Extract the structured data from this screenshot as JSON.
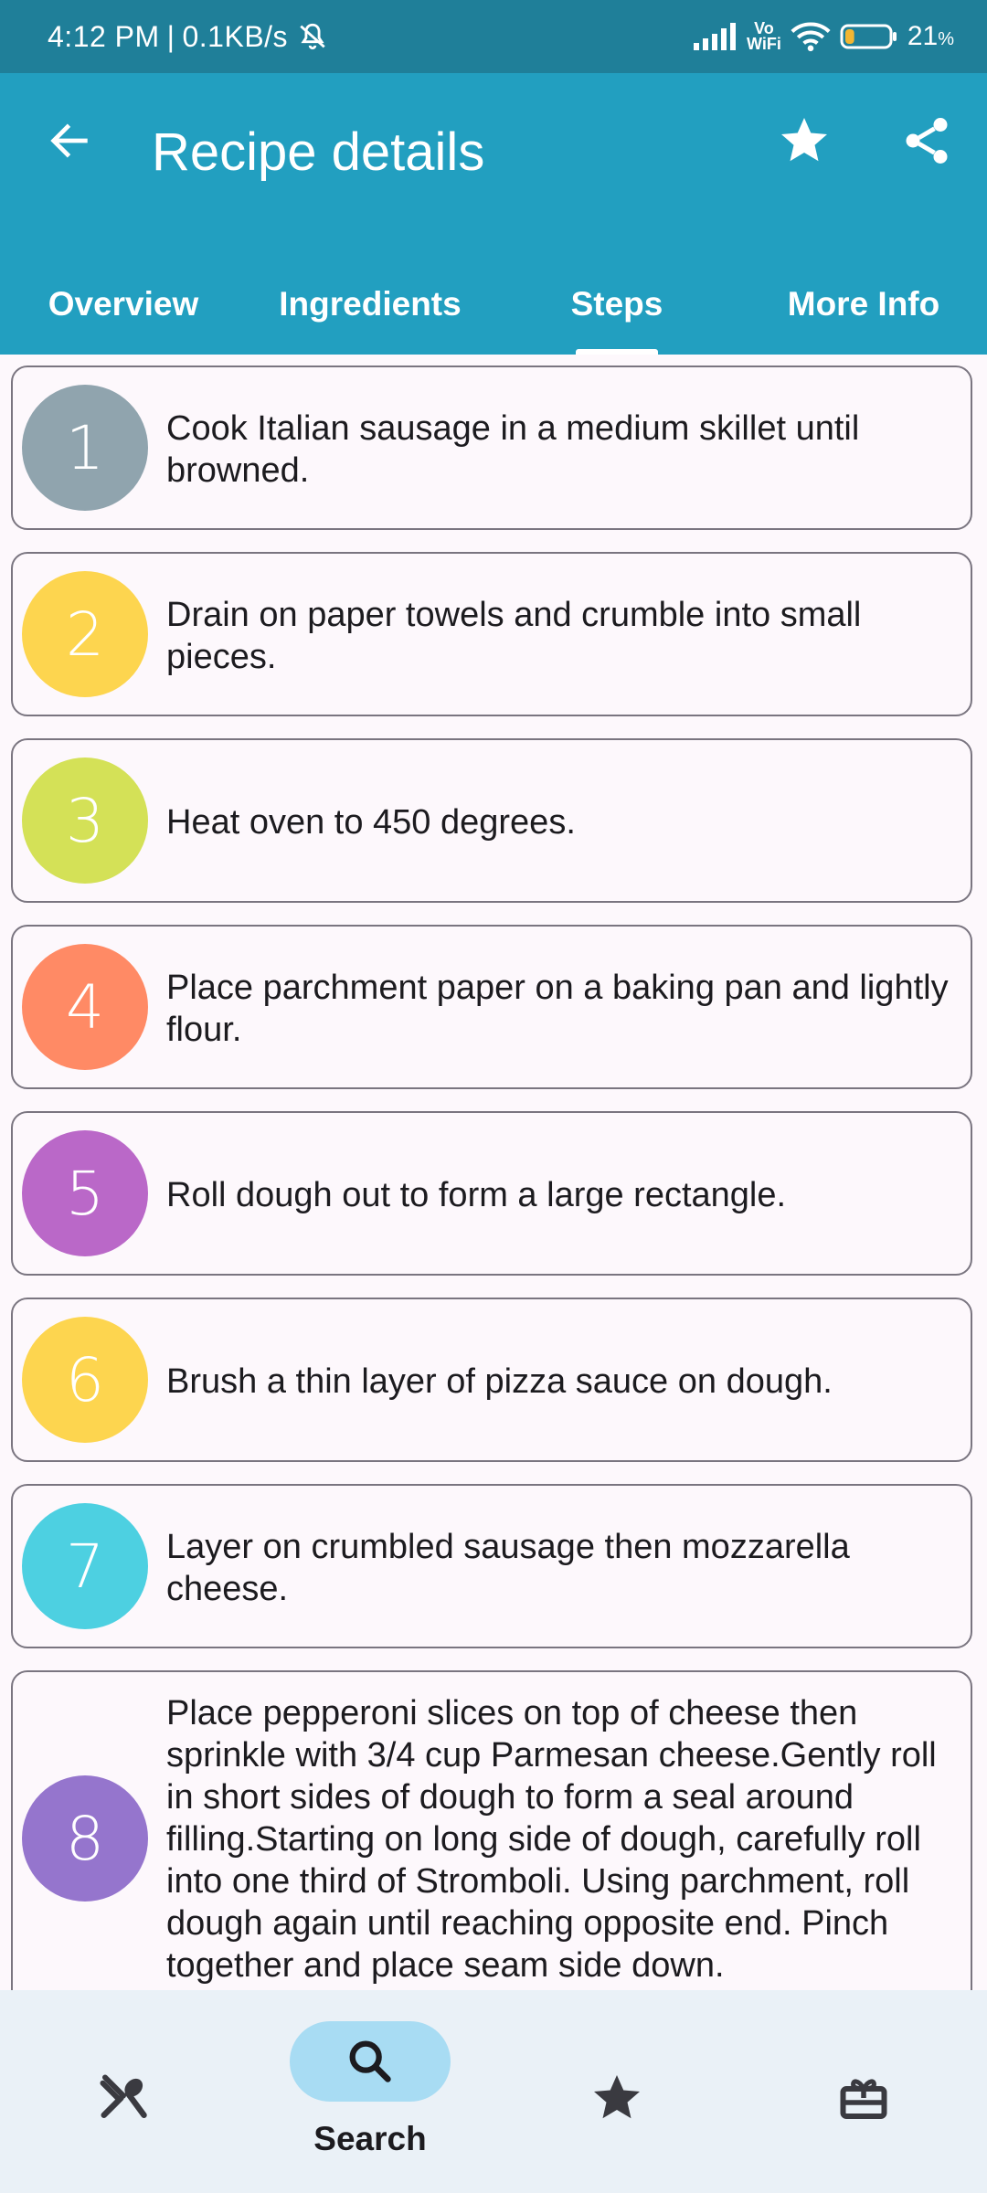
{
  "status_bar": {
    "time": "4:12 PM",
    "separator": "|",
    "speed": "0.1KB/s",
    "vo_label": "Vo",
    "wifi_label": "WiFi",
    "battery_percent": "21",
    "percent_sign": "%",
    "battery_level": 0.21
  },
  "app_bar": {
    "title": "Recipe details",
    "icons": [
      "back-arrow-icon",
      "star-icon",
      "share-icon"
    ]
  },
  "tabs": [
    {
      "label": "Overview",
      "selected": false
    },
    {
      "label": "Ingredients",
      "selected": false
    },
    {
      "label": "Steps",
      "selected": true
    },
    {
      "label": "More Info",
      "selected": false
    }
  ],
  "steps": [
    {
      "number": "1",
      "text": "Cook Italian sausage in a medium skillet until browned.",
      "color": "#90a4ae"
    },
    {
      "number": "2",
      "text": "Drain on paper towels and crumble into small pieces.",
      "color": "#fdd54f"
    },
    {
      "number": "3",
      "text": "Heat oven to 450 degrees.",
      "color": "#d4e157"
    },
    {
      "number": "4",
      "text": "Place parchment paper on a baking pan and lightly flour.",
      "color": "#ff8a65"
    },
    {
      "number": "5",
      "text": "Roll dough out to form a large rectangle.",
      "color": "#ba68c8"
    },
    {
      "number": "6",
      "text": "Brush a thin layer of pizza sauce on dough.",
      "color": "#fdd54f"
    },
    {
      "number": "7",
      "text": "Layer on crumbled sausage then mozzarella cheese.",
      "color": "#4dd0e1"
    },
    {
      "number": "8",
      "text": "Place pepperoni slices on top of cheese then sprinkle with 3/4 cup Parmesan cheese.Gently roll in short sides of dough to form a seal around filling.Starting on long side of dough, carefully roll into one third of Stromboli. Using parchment, roll dough again until reaching opposite end. Pinch together and place seam side down.",
      "color": "#9575cd"
    }
  ],
  "bottom_nav": {
    "items": [
      {
        "icon": "utensils-icon",
        "label": "",
        "selected": false
      },
      {
        "icon": "search-icon",
        "label": "Search",
        "selected": true
      },
      {
        "icon": "star-icon",
        "label": "",
        "selected": false
      },
      {
        "icon": "gift-icon",
        "label": "",
        "selected": false
      }
    ]
  },
  "colors": {
    "status_bar": "#1f7f99",
    "app_bar": "#229fc0",
    "background": "#fdf8fc",
    "nav_background": "#eaf1f7",
    "nav_pill": "#a8dcf3"
  }
}
